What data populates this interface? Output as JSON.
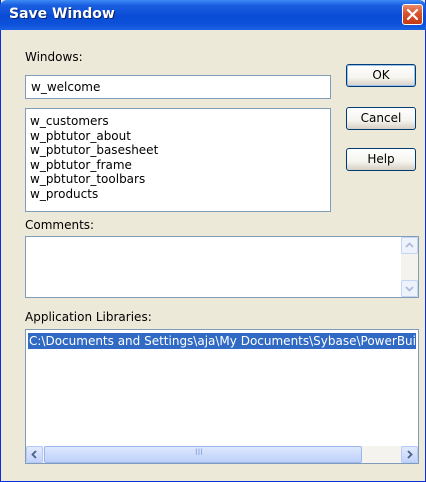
{
  "dialog": {
    "title": "Save Window",
    "windows_label": "Windows:",
    "window_name": "w_welcome",
    "window_list": [
      "w_customers",
      "w_pbtutor_about",
      "w_pbtutor_basesheet",
      "w_pbtutor_frame",
      "w_pbtutor_toolbars",
      "w_products"
    ],
    "comments_label": "Comments:",
    "comments_value": "",
    "libraries_label": "Application Libraries:",
    "libraries": [
      "C:\\Documents and Settings\\aja\\My Documents\\Sybase\\PowerBuilder"
    ],
    "scroll_grip": "III"
  },
  "buttons": {
    "ok": "OK",
    "cancel": "Cancel",
    "help": "Help"
  },
  "colors": {
    "title_bar": "#0a4bd6",
    "close_button": "#d8522b",
    "selection": "#316ac5",
    "dialog_bg": "#ece9d8"
  }
}
